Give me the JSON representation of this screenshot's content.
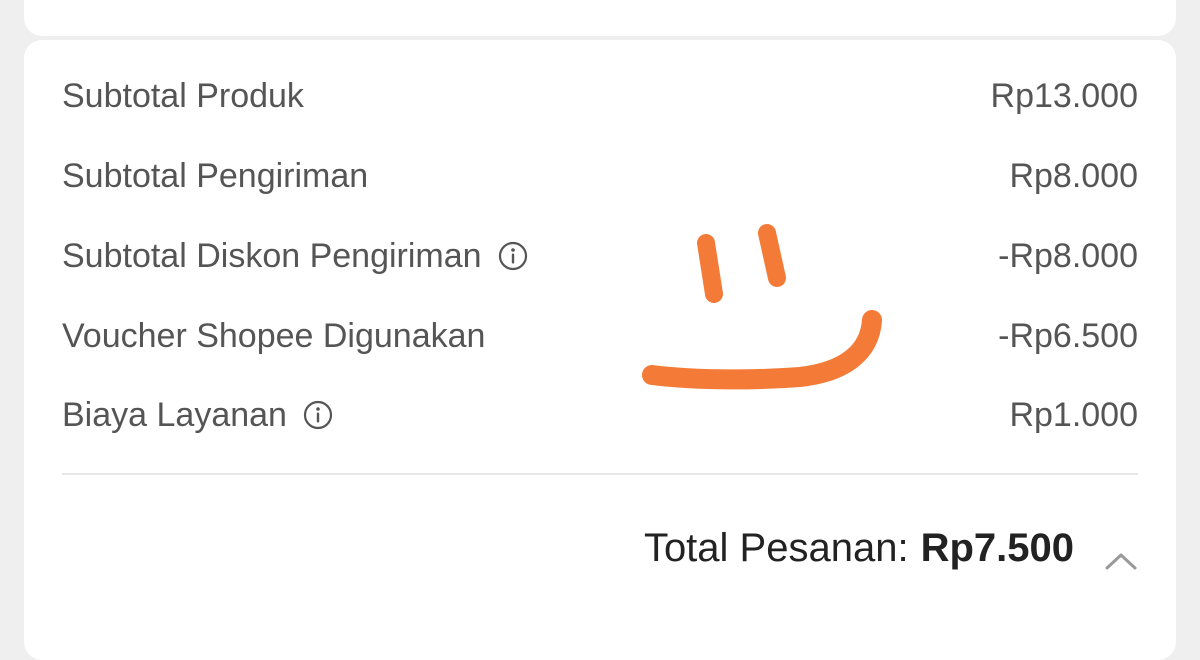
{
  "summary": {
    "rows": [
      {
        "label": "Subtotal Produk",
        "value": "Rp13.000",
        "info": false
      },
      {
        "label": "Subtotal Pengiriman",
        "value": "Rp8.000",
        "info": false
      },
      {
        "label": "Subtotal Diskon Pengiriman",
        "value": "-Rp8.000",
        "info": true
      },
      {
        "label": "Voucher Shopee Digunakan",
        "value": "-Rp6.500",
        "info": false
      },
      {
        "label": "Biaya Layanan",
        "value": "Rp1.000",
        "info": true
      }
    ],
    "total_label": "Total Pesanan:",
    "total_value": "Rp7.500"
  },
  "icons": {
    "info": "info-circle-icon",
    "toggle": "chevron-up-icon"
  },
  "colors": {
    "doodle": "#f47a38",
    "text": "#555555",
    "total_text": "#222222"
  }
}
